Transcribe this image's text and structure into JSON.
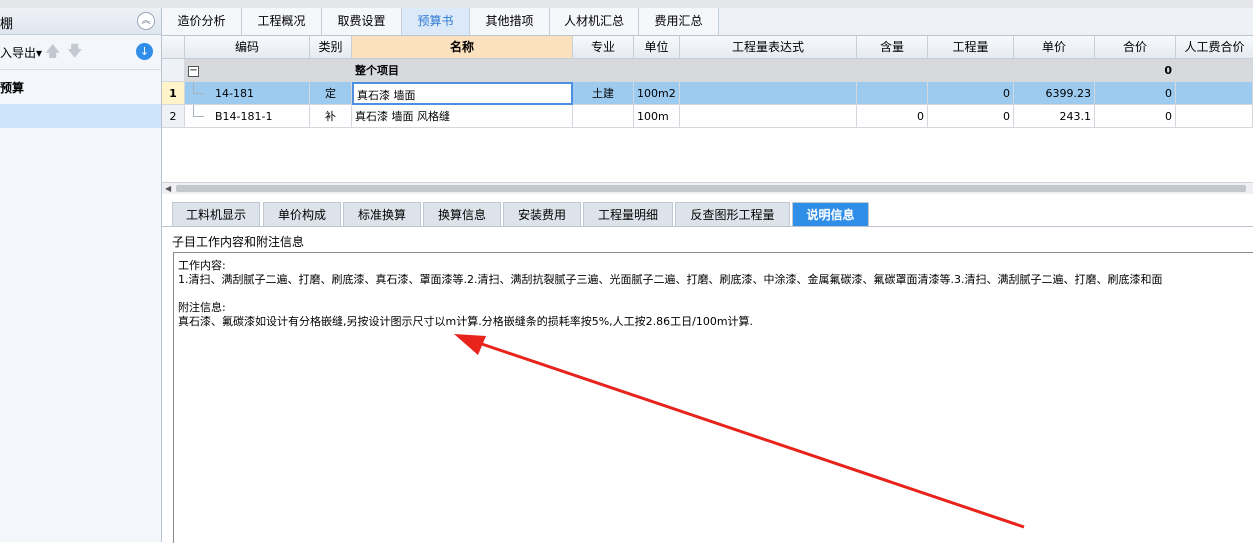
{
  "left_panel": {
    "title": "棚",
    "export_label": "入导出",
    "tree_item": "预算"
  },
  "top_tabs": [
    {
      "label": "造价分析",
      "active": false
    },
    {
      "label": "工程概况",
      "active": false
    },
    {
      "label": "取费设置",
      "active": false
    },
    {
      "label": "预算书",
      "active": true
    },
    {
      "label": "其他措项",
      "active": false
    },
    {
      "label": "人材机汇总",
      "active": false
    },
    {
      "label": "费用汇总",
      "active": false
    }
  ],
  "grid": {
    "headers": [
      "编码",
      "类别",
      "名称",
      "专业",
      "单位",
      "工程量表达式",
      "含量",
      "工程量",
      "单价",
      "合价",
      "人工费合价"
    ],
    "group_row": {
      "name": "整个项目",
      "total": "0"
    },
    "rows": [
      {
        "num": "1",
        "code": "14-181",
        "type": "定",
        "name": "真石漆 墙面",
        "major": "土建",
        "unit": "100m2",
        "expr": "",
        "content": "",
        "quantity": "0",
        "price": "6399.23",
        "total": "0"
      },
      {
        "num": "2",
        "code": "B14-181-1",
        "type": "补",
        "name": "真石漆 墙面 风格缝",
        "major": "",
        "unit": "100m",
        "expr": "",
        "content": "0",
        "quantity": "0",
        "price": "243.1",
        "total": "0"
      }
    ]
  },
  "bottom_tabs": [
    {
      "label": "工料机显示",
      "active": false
    },
    {
      "label": "单价构成",
      "active": false
    },
    {
      "label": "标准换算",
      "active": false
    },
    {
      "label": "换算信息",
      "active": false
    },
    {
      "label": "安装费用",
      "active": false
    },
    {
      "label": "工程量明细",
      "active": false
    },
    {
      "label": "反查图形工程量",
      "active": false
    },
    {
      "label": "说明信息",
      "active": true
    }
  ],
  "description": {
    "section_title": "子目工作内容和附注信息",
    "work_label": "工作内容:",
    "work_text": "1.清扫、满刮腻子二遍、打磨、刷底漆、真石漆、罩面漆等.2.清扫、满刮抗裂腻子三遍、光面腻子二遍、打磨、刷底漆、中涂漆、金属氟碳漆、氟碳罩面清漆等.3.清扫、满刮腻子二遍、打磨、刷底漆和面",
    "note_label": "附注信息:",
    "note_text": "真石漆、氟碳漆如设计有分格嵌缝,另按设计图示尺寸以m计算.分格嵌缝条的损耗率按5%,人工按2.86工日/100m计算."
  },
  "colors": {
    "accent": "#2f8ee8",
    "selected_row": "#9dcbf0",
    "annotation_arrow": "#e8231c"
  }
}
